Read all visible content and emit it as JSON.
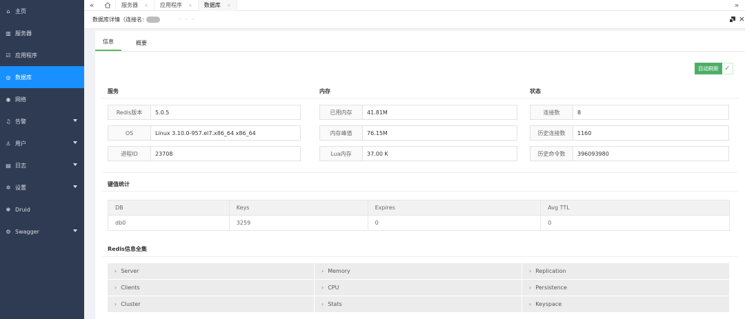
{
  "sidebar": {
    "items": [
      {
        "label": "主页",
        "icon": "home-icon",
        "glyph": "⌂",
        "active": false,
        "caret": false
      },
      {
        "label": "服务器",
        "icon": "server-icon",
        "glyph": "▥",
        "active": false,
        "caret": false
      },
      {
        "label": "应用程序",
        "icon": "application-icon",
        "glyph": "☑",
        "active": false,
        "caret": false
      },
      {
        "label": "数据库",
        "icon": "database-icon",
        "glyph": "◎",
        "active": true,
        "caret": false
      },
      {
        "label": "网络",
        "icon": "network-icon",
        "glyph": "◉",
        "active": false,
        "caret": false
      },
      {
        "label": "告警",
        "icon": "bell-icon",
        "glyph": "♫",
        "active": false,
        "caret": true
      },
      {
        "label": "用户",
        "icon": "user-icon",
        "glyph": "♙",
        "active": false,
        "caret": true
      },
      {
        "label": "日志",
        "icon": "log-icon",
        "glyph": "▤",
        "active": false,
        "caret": true
      },
      {
        "label": "设置",
        "icon": "gear-icon",
        "glyph": "✲",
        "active": false,
        "caret": true
      },
      {
        "label": "Druid",
        "icon": "druid-icon",
        "glyph": "❃",
        "active": false,
        "caret": false
      },
      {
        "label": "Swagger",
        "icon": "swagger-icon",
        "glyph": "⚙",
        "active": false,
        "caret": true
      }
    ]
  },
  "tabbar": {
    "tabs": [
      {
        "label": "服务器",
        "active": false
      },
      {
        "label": "应用程序",
        "active": false
      },
      {
        "label": "数据库",
        "active": true
      }
    ],
    "close_glyph": "×"
  },
  "header": {
    "title": "数据库详情（连接名:",
    "masked": "· · ·"
  },
  "subtabs": [
    "信息",
    "概要"
  ],
  "refresh": {
    "label": "自动刷新",
    "check": "✓"
  },
  "sections": {
    "service": "服务",
    "memory": "内存",
    "status": "状态",
    "keystats": "键值统计",
    "redisinfo": "Redis信息全集"
  },
  "service": [
    {
      "key": "Redis版本",
      "value": "5.0.5"
    },
    {
      "key": "OS",
      "value": "Linux 3.10.0-957.el7.x86_64 x86_64"
    },
    {
      "key": "进程ID",
      "value": "23708"
    }
  ],
  "memory": [
    {
      "key": "已用内存",
      "value": "41.81M"
    },
    {
      "key": "内存峰值",
      "value": "76.15M"
    },
    {
      "key": "Lua内存",
      "value": "37.00 K"
    }
  ],
  "status": [
    {
      "key": "连接数",
      "value": "8"
    },
    {
      "key": "历史连接数",
      "value": "1160"
    },
    {
      "key": "历史命令数",
      "value": "396093980"
    }
  ],
  "keytable": {
    "headers": [
      "DB",
      "Keys",
      "Expires",
      "Avg TTL"
    ],
    "rows": [
      [
        "db0",
        "3259",
        "0",
        "0"
      ]
    ]
  },
  "info_items": [
    "Server",
    "Memory",
    "Replication",
    "Clients",
    "CPU",
    "Persistence",
    "Cluster",
    "Stats",
    "Keyspace"
  ],
  "chevron": "›"
}
